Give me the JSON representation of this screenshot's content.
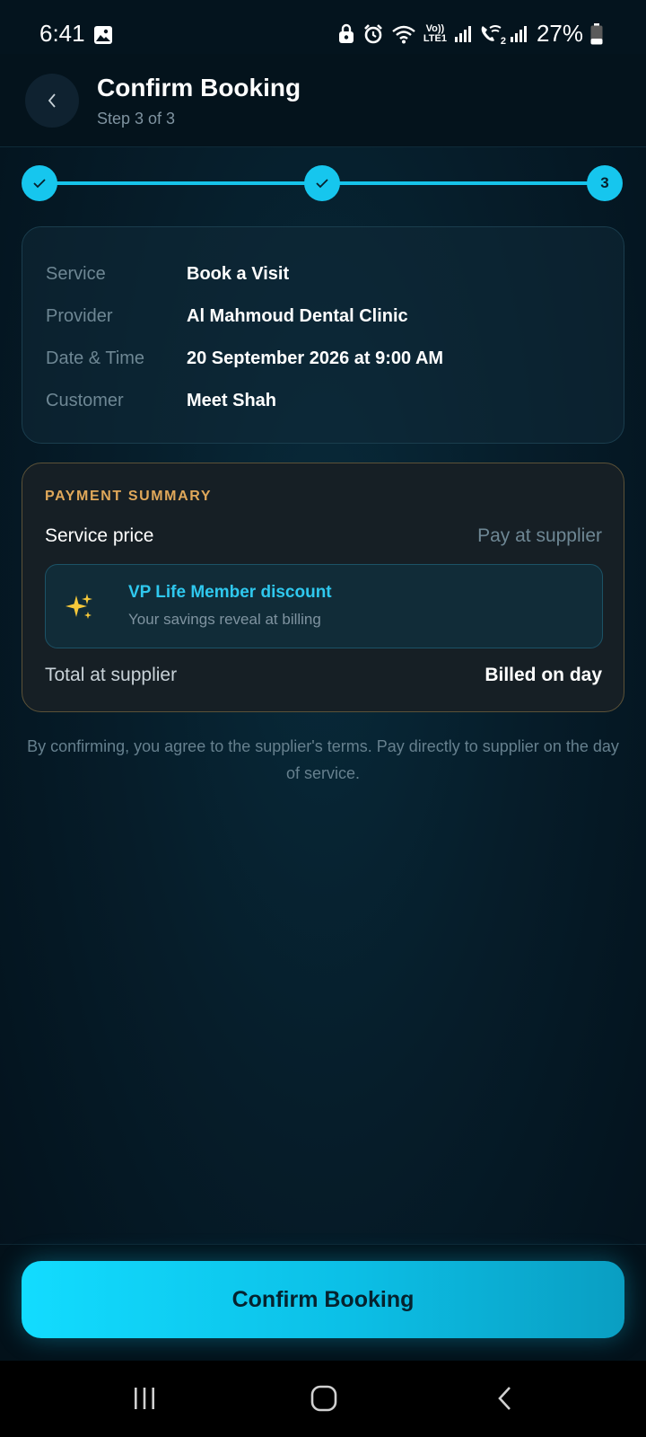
{
  "status_bar": {
    "time": "6:41",
    "network_label_top": "Vo))",
    "network_label_bottom": "LTE1",
    "sim2_label": "2",
    "battery": "27%",
    "icons": [
      "gallery-icon",
      "lock-shield-icon",
      "alarm-icon",
      "wifi-icon",
      "signal-icon",
      "wifi-calling-icon",
      "signal-icon",
      "battery-icon"
    ]
  },
  "header": {
    "title": "Confirm Booking",
    "subtitle": "Step 3 of 3",
    "back_icon": "chevron-left-icon"
  },
  "stepper": {
    "current": 3,
    "total": 3,
    "step3_label": "3"
  },
  "details": {
    "service_label": "Service",
    "service_value": "Book a Visit",
    "provider_label": "Provider",
    "provider_value": "Al Mahmoud Dental Clinic",
    "datetime_label": "Date & Time",
    "datetime_value": "20 September 2026 at 9:00 AM",
    "customer_label": "Customer",
    "customer_value": "Meet Shah"
  },
  "payment": {
    "heading": "PAYMENT SUMMARY",
    "service_price_label": "Service price",
    "service_price_value": "Pay at supplier",
    "discount_title": "VP Life Member discount",
    "discount_subtitle": "Your savings reveal at billing",
    "total_label": "Total at supplier",
    "total_value": "Billed on day"
  },
  "terms": "By confirming, you agree to the supplier's terms. Pay directly to supplier on the day of service.",
  "confirm_button": "Confirm Booking",
  "colors": {
    "accent": "#16c6ee",
    "payment_heading": "#e0a85a",
    "background": "#061d2a"
  }
}
